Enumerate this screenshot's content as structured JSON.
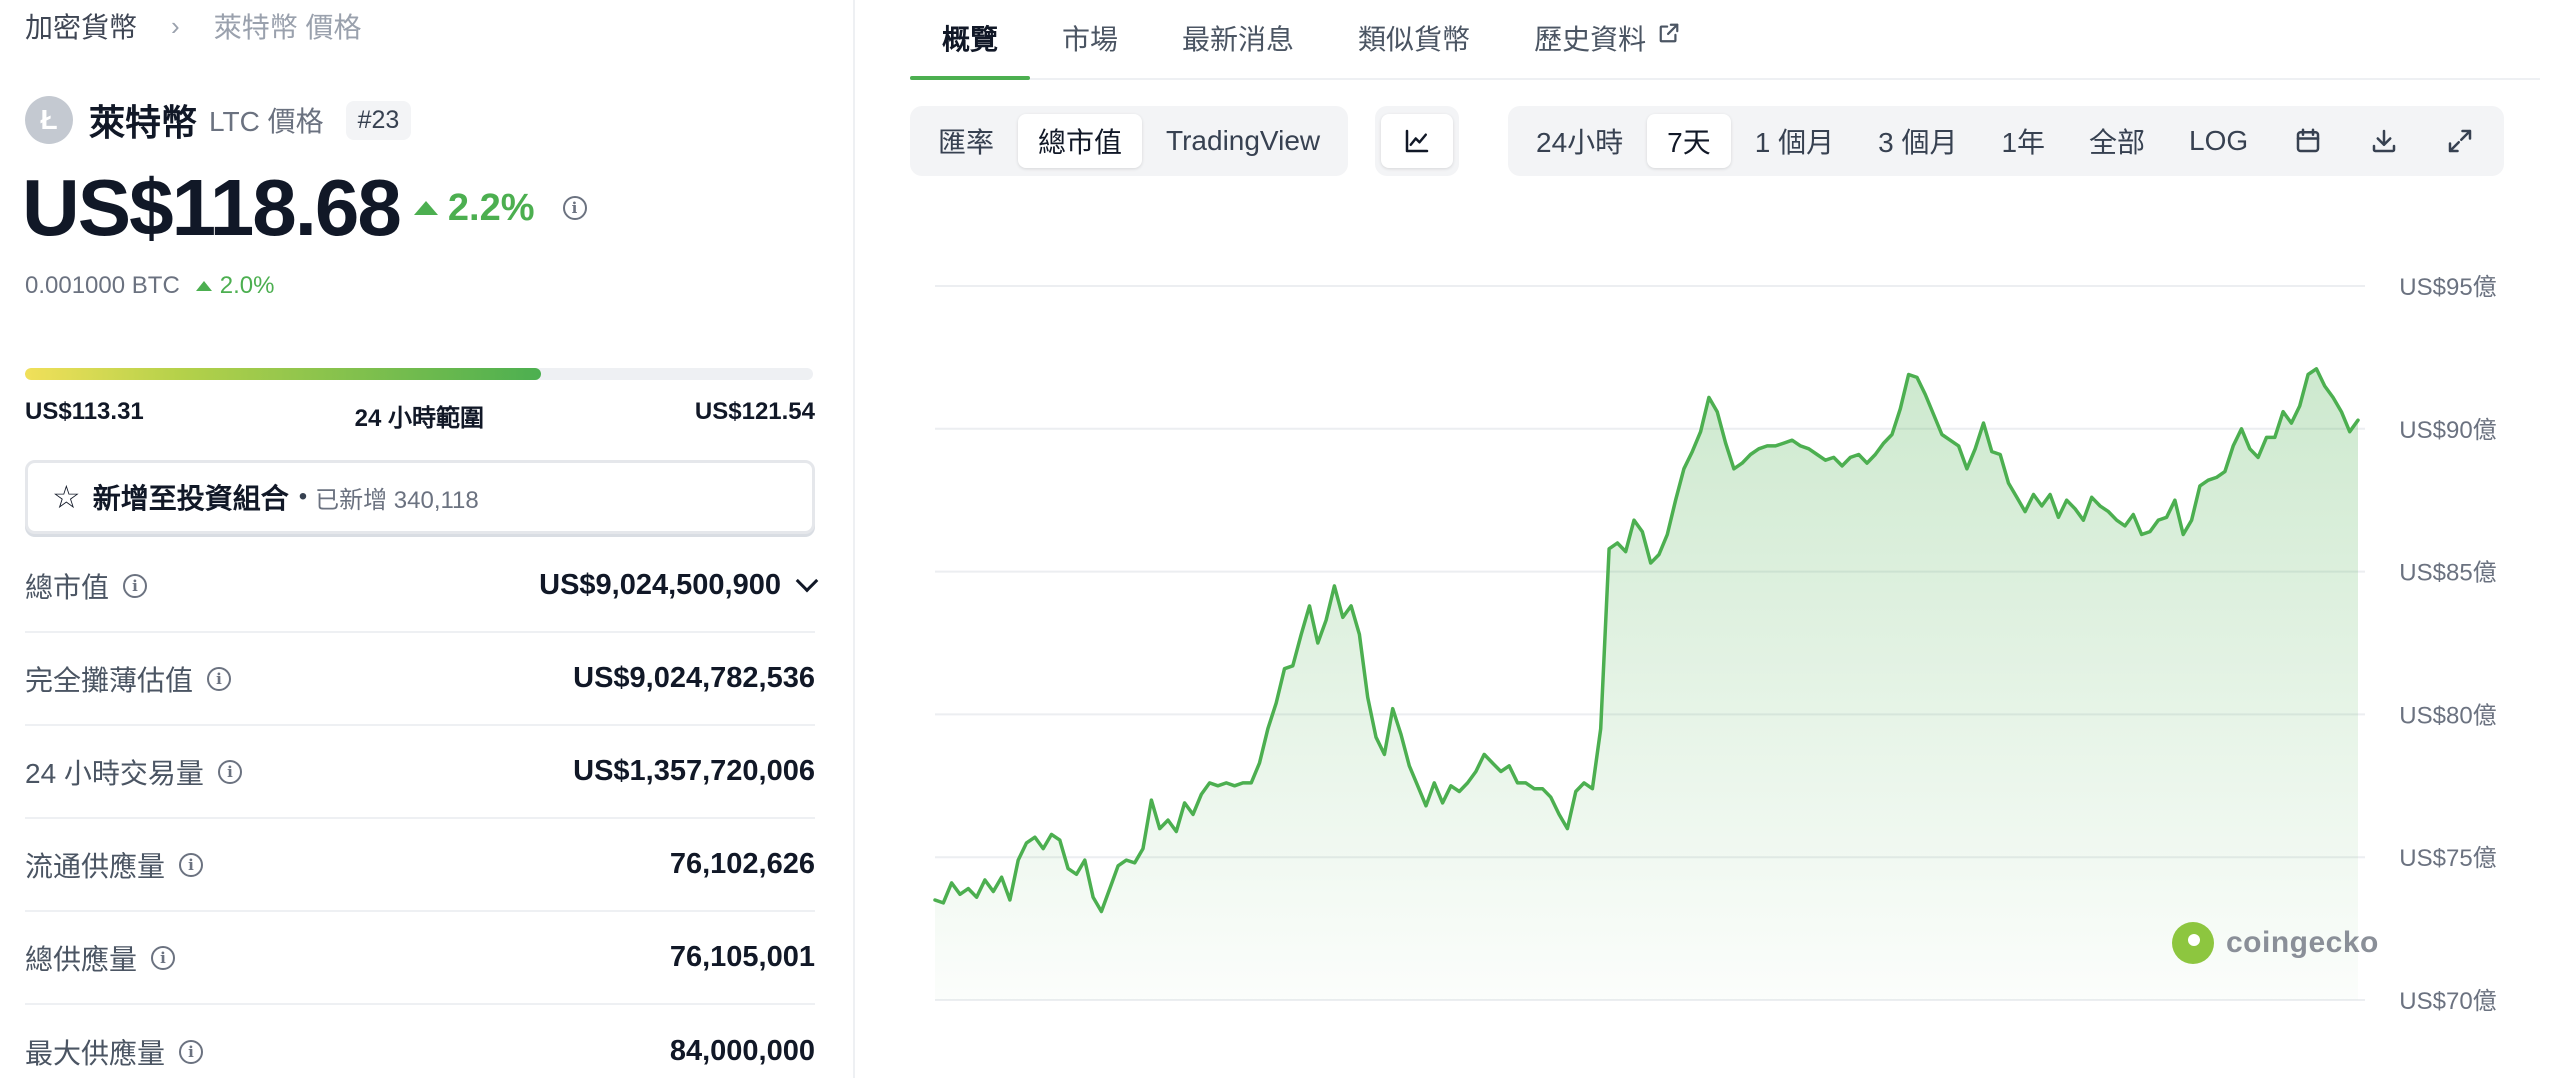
{
  "breadcrumb": {
    "root": "加密貨幣",
    "separator": "›",
    "current": "萊特幣 價格"
  },
  "coin": {
    "logo_glyph": "Ł",
    "name": "萊特幣",
    "symbol_label": "LTC 價格",
    "rank": "#23"
  },
  "price": {
    "usd": "US$118.68",
    "change_pct": "2.2%",
    "btc": "0.001000 BTC",
    "btc_change_pct": "2.0%"
  },
  "range_24h": {
    "low": "US$113.31",
    "label": "24 小時範圍",
    "high": "US$121.54",
    "fill_fraction": 0.655
  },
  "portfolio": {
    "label": "新增至投資組合",
    "dot": "•",
    "added_text": "已新增 340,118"
  },
  "stats": [
    {
      "label": "總市值",
      "value": "US$9,024,500,900",
      "has_dropdown": true
    },
    {
      "label": "完全攤薄估值",
      "value": "US$9,024,782,536"
    },
    {
      "label": "24 小時交易量",
      "value": "US$1,357,720,006"
    },
    {
      "label": "流通供應量",
      "value": "76,102,626"
    },
    {
      "label": "總供應量",
      "value": "76,105,001"
    },
    {
      "label": "最大供應量",
      "value": "84,000,000"
    }
  ],
  "tabs": [
    {
      "label": "概覽",
      "active": true
    },
    {
      "label": "市場"
    },
    {
      "label": "最新消息"
    },
    {
      "label": "類似貨幣"
    },
    {
      "label": "歷史資料",
      "external": true
    }
  ],
  "chart_toolbar": {
    "metric_buttons": [
      "匯率",
      "總市值",
      "TradingView"
    ],
    "active_metric": "總市值",
    "chart_type_icon": "line-chart-icon",
    "range_buttons": [
      "24小時",
      "7天",
      "1 個月",
      "3 個月",
      "1年",
      "全部",
      "LOG"
    ],
    "active_range": "7天",
    "action_icons": [
      "calendar-icon",
      "download-icon",
      "expand-icon"
    ]
  },
  "watermark": "coingecko",
  "colors": {
    "accent": "#4caf50",
    "line": "#4caf50",
    "fill": "#dff1e0"
  },
  "chart_data": {
    "type": "area",
    "title": "",
    "xlabel": "",
    "ylabel": "",
    "y_ticks": [
      "US$95億",
      "US$90億",
      "US$85億",
      "US$80億",
      "US$75億",
      "US$70億"
    ],
    "y_tick_values": [
      95,
      90,
      85,
      80,
      75,
      70
    ],
    "ylim": [
      70,
      97.5
    ],
    "y_unit": "億 USD",
    "grid": true,
    "legend": "none",
    "series": [
      {
        "values": [
          73.5,
          73.4,
          74.1,
          73.7,
          73.9,
          73.6,
          74.2,
          73.8,
          74.3,
          73.5,
          74.9,
          75.5,
          75.7,
          75.3,
          75.8,
          75.6,
          74.6,
          74.4,
          74.9,
          73.6,
          73.1,
          73.9,
          74.7,
          74.9,
          74.8,
          75.3,
          77.0,
          76.0,
          76.3,
          75.9,
          76.9,
          76.5,
          77.2,
          77.6,
          77.5,
          77.6,
          77.5,
          77.6,
          77.6,
          78.3,
          79.5,
          80.4,
          81.6,
          81.7,
          82.8,
          83.8,
          82.5,
          83.3,
          84.5,
          83.4,
          83.8,
          82.8,
          80.6,
          79.2,
          78.6,
          80.2,
          79.3,
          78.2,
          77.5,
          76.8,
          77.6,
          76.9,
          77.5,
          77.3,
          77.6,
          78.0,
          78.6,
          78.3,
          78.0,
          78.2,
          77.6,
          77.6,
          77.4,
          77.4,
          77.1,
          76.5,
          76.0,
          77.3,
          77.6,
          77.4,
          79.5,
          85.8,
          86.0,
          85.7,
          86.8,
          86.4,
          85.3,
          85.6,
          86.3,
          87.5,
          88.6,
          89.2,
          89.9,
          91.1,
          90.6,
          89.5,
          88.6,
          88.8,
          89.1,
          89.3,
          89.4,
          89.4,
          89.5,
          89.6,
          89.4,
          89.3,
          89.1,
          88.9,
          89.0,
          88.7,
          89.0,
          89.1,
          88.8,
          89.1,
          89.5,
          89.8,
          90.7,
          91.9,
          91.8,
          91.2,
          90.5,
          89.8,
          89.6,
          89.4,
          88.6,
          89.3,
          90.2,
          89.2,
          89.1,
          88.1,
          87.6,
          87.1,
          87.7,
          87.3,
          87.7,
          86.9,
          87.5,
          87.2,
          86.8,
          87.6,
          87.3,
          87.1,
          86.8,
          86.6,
          87.0,
          86.3,
          86.4,
          86.8,
          86.9,
          87.5,
          86.3,
          86.8,
          88.0,
          88.2,
          88.3,
          88.5,
          89.4,
          90.0,
          89.3,
          89.0,
          89.7,
          89.7,
          90.6,
          90.2,
          90.8,
          91.9,
          92.1,
          91.5,
          91.1,
          90.6,
          89.9,
          90.3
        ]
      }
    ]
  }
}
